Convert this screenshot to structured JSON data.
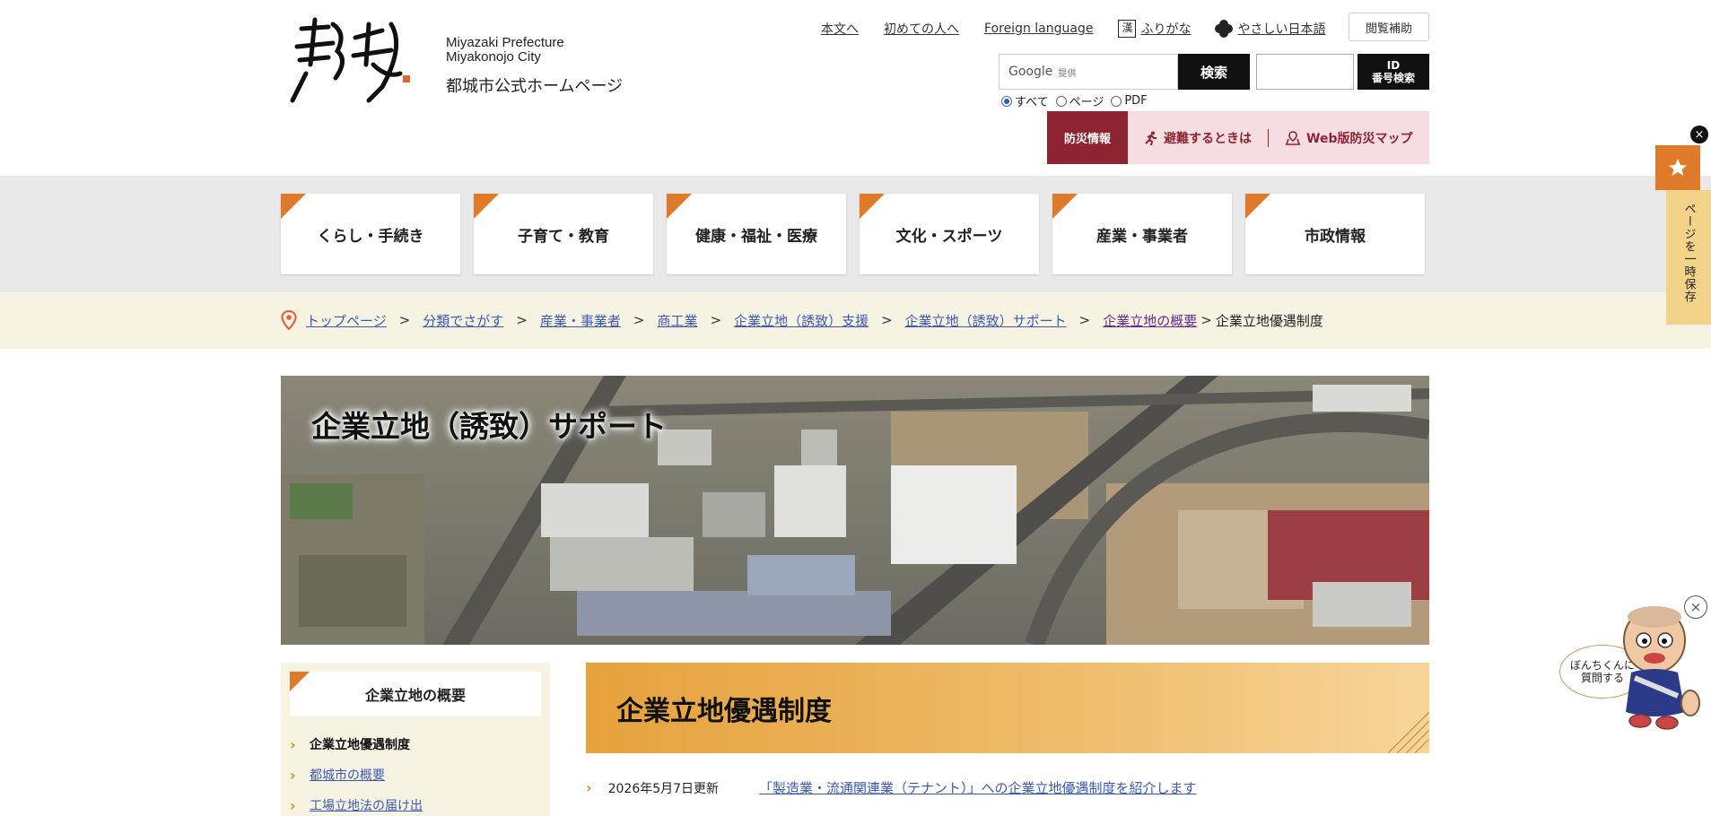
{
  "header": {
    "logo_en_line1": "Miyazaki Prefecture",
    "logo_en_line2": "Miyakonojo City",
    "logo_ja": "都城市公式ホームページ",
    "links": {
      "main_text": "本文へ",
      "first_time": "初めての人へ",
      "foreign_language": "Foreign language",
      "furigana_icon": "漢",
      "furigana": "ふりがな",
      "easy_japanese": "やさしい日本語"
    },
    "assist_button": "閲覧補助",
    "search": {
      "google_label": "Google",
      "provided": "提供",
      "button": "検索",
      "id_button_line1": "ID",
      "id_button_line2": "番号検索",
      "scope_options": [
        "すべて",
        "ページ",
        "PDF"
      ],
      "selected_scope": "すべて"
    },
    "disaster": {
      "tag": "防災情報",
      "evacuate": "避難するときは",
      "map": "Web版防災マップ"
    }
  },
  "gnav": {
    "items": [
      "くらし・手続き",
      "子育て・教育",
      "健康・福祉・医療",
      "文化・スポーツ",
      "産業・事業者",
      "市政情報"
    ]
  },
  "breadcrumb": {
    "items": [
      "トップページ",
      "分類でさがす",
      "産業・事業者",
      "商工業",
      "企業立地（誘致）支援",
      "企業立地（誘致）サポート",
      "企業立地の概要"
    ],
    "separator": ">",
    "current": "企業立地優遇制度"
  },
  "hero": {
    "title": "企業立地（誘致）サポート"
  },
  "side": {
    "heading": "企業立地の概要",
    "items": [
      "企業立地優遇制度",
      "都城市の概要",
      "工場立地法の届け出"
    ]
  },
  "main": {
    "title": "企業立地優遇制度",
    "update_date": "2026年5月7日更新",
    "update_link": "「製造業・流通関連業（テナント）」への企業立地優遇制度を紹介します"
  },
  "floating": {
    "save_label": "ページを一時保存",
    "bubble_line1": "ぼんちくんに",
    "bubble_line2": "質問する",
    "close_glyph": "×"
  },
  "colors": {
    "accent_orange": "#e07a2b",
    "disaster_red": "#8e2331",
    "link_blue": "#3c5ab5",
    "breadcrumb_bg": "#f7f3e3"
  }
}
